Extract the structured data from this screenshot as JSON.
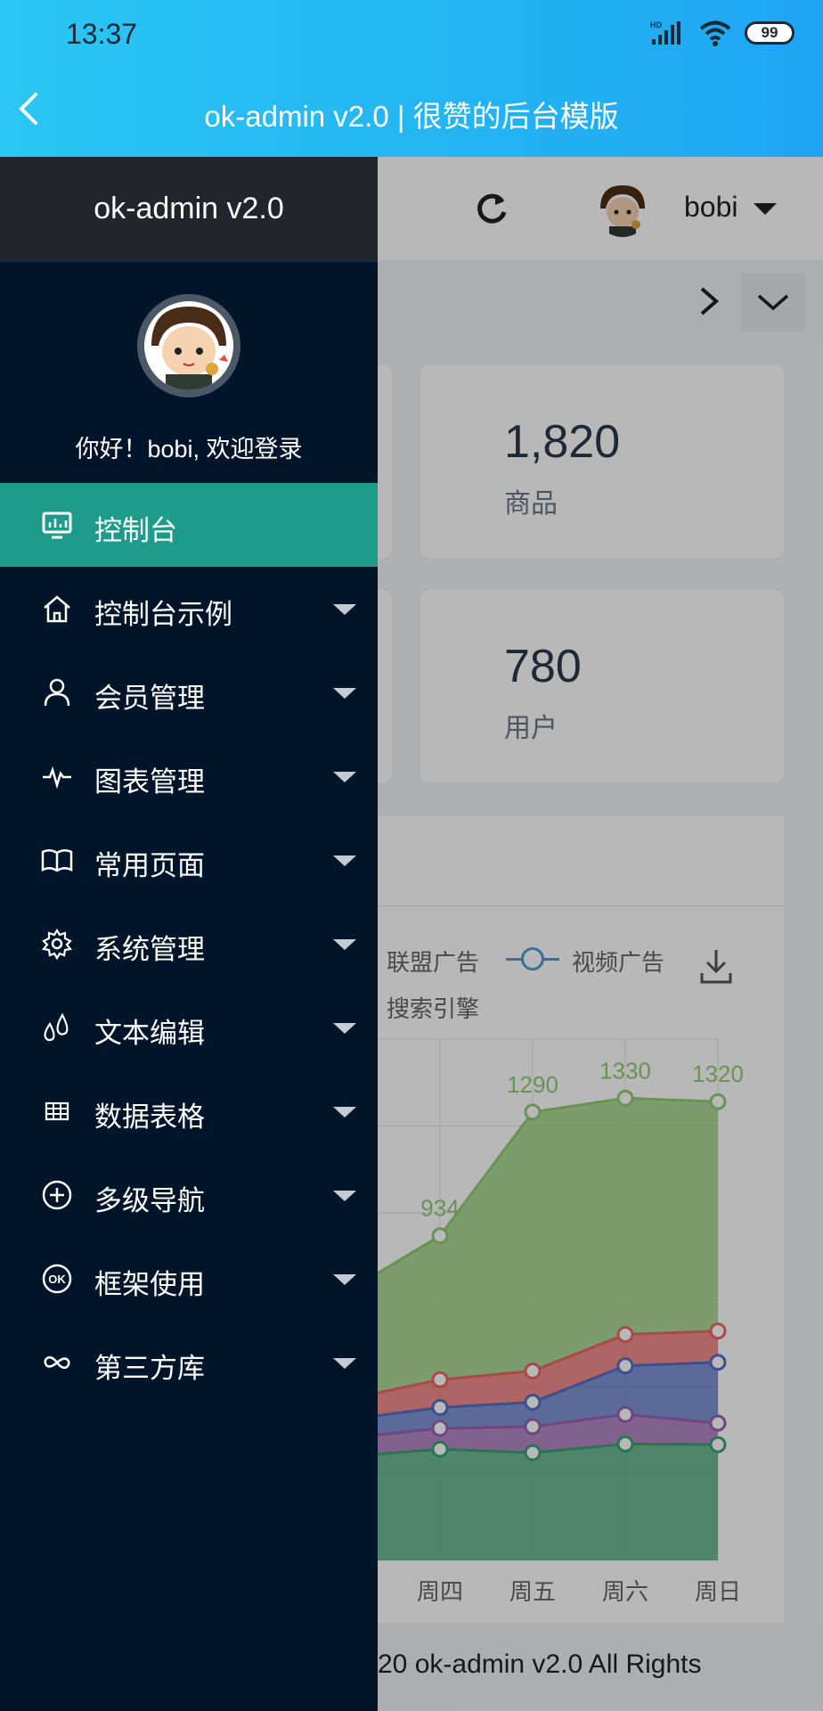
{
  "status": {
    "time": "13:37",
    "battery": "99",
    "signal_label": "HD"
  },
  "titlebar": {
    "title": "ok-admin v2.0 | 很赞的后台模版"
  },
  "drawer": {
    "brand": "ok-admin v2.0",
    "welcome": "你好！bobi, 欢迎登录",
    "menu": [
      {
        "label": "控制台",
        "icon": "monitor-icon",
        "active": true,
        "has_children": false
      },
      {
        "label": "控制台示例",
        "icon": "home-icon",
        "active": false,
        "has_children": true
      },
      {
        "label": "会员管理",
        "icon": "user-icon",
        "active": false,
        "has_children": true
      },
      {
        "label": "图表管理",
        "icon": "pulse-icon",
        "active": false,
        "has_children": true
      },
      {
        "label": "常用页面",
        "icon": "book-icon",
        "active": false,
        "has_children": true
      },
      {
        "label": "系统管理",
        "icon": "gear-icon",
        "active": false,
        "has_children": true
      },
      {
        "label": "文本编辑",
        "icon": "drops-icon",
        "active": false,
        "has_children": true
      },
      {
        "label": "数据表格",
        "icon": "table-icon",
        "active": false,
        "has_children": true
      },
      {
        "label": "多级导航",
        "icon": "plus-circle-icon",
        "active": false,
        "has_children": true
      },
      {
        "label": "框架使用",
        "icon": "ok-icon",
        "active": false,
        "has_children": true
      },
      {
        "label": "第三方库",
        "icon": "infinity-icon",
        "active": false,
        "has_children": true
      }
    ]
  },
  "header": {
    "user_name": "bobi"
  },
  "stats": [
    {
      "value": "1,820",
      "label": "商品"
    },
    {
      "value": "780",
      "label": "用户"
    }
  ],
  "chart_legend": {
    "item1": "联盟广告",
    "item2": "视频广告",
    "item3": "搜索引擎"
  },
  "chart_data": {
    "type": "area",
    "categories": [
      "周四",
      "周五",
      "周六",
      "周日"
    ],
    "series": [
      {
        "name": "搜索引擎",
        "values": [
          934,
          1290,
          1330,
          1320
        ],
        "color": "#91cc75"
      },
      {
        "name": "",
        "values": [
          null,
          null,
          null,
          null
        ],
        "color": "#ee6666"
      },
      {
        "name": "视频广告",
        "values": [
          null,
          null,
          null,
          null
        ],
        "color": "#5470c6"
      },
      {
        "name": "",
        "values": [
          null,
          null,
          null,
          null
        ],
        "color": "#9a60b4"
      },
      {
        "name": "",
        "values": [
          null,
          null,
          null,
          null
        ],
        "color": "#3ba272"
      }
    ],
    "data_labels": [
      "934",
      "1290",
      "1330",
      "1320"
    ]
  },
  "footer": {
    "text": "20 ok-admin v2.0 All Rights"
  }
}
